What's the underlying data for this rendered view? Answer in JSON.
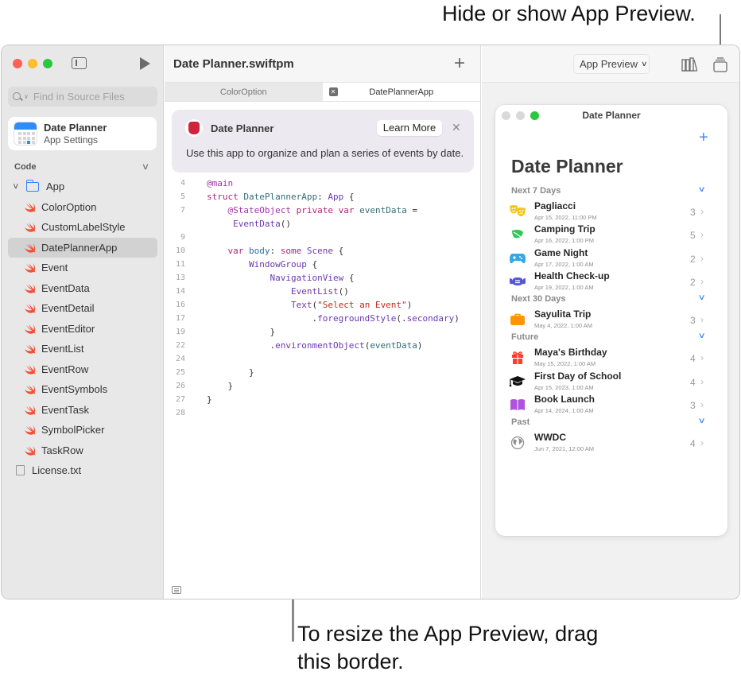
{
  "callouts": {
    "top": "Hide or show App Preview.",
    "bottom": "To resize the App Preview, drag this border."
  },
  "sidebar": {
    "search_placeholder": "Find in Source Files",
    "app_settings": {
      "title": "Date Planner",
      "subtitle": "App Settings"
    },
    "section_label": "Code",
    "folder": "App",
    "files": [
      "ColorOption",
      "CustomLabelStyle",
      "DatePlannerApp",
      "Event",
      "EventData",
      "EventDetail",
      "EventEditor",
      "EventList",
      "EventRow",
      "EventSymbols",
      "EventTask",
      "SymbolPicker",
      "TaskRow"
    ],
    "selected_file": "DatePlannerApp",
    "extra_file": "License.txt"
  },
  "editor": {
    "project_title": "Date Planner.swiftpm",
    "tabs": [
      {
        "label": "ColorOption",
        "active": false
      },
      {
        "label": "DatePlannerApp",
        "active": true
      }
    ],
    "banner": {
      "title": "Date Planner",
      "learn_more": "Learn More",
      "description": "Use this app to organize and plan a series of events by date."
    },
    "code_line_numbers": [
      "4",
      "5",
      "7",
      "",
      "9",
      "10",
      "11",
      "13",
      "14",
      "16",
      "17",
      "19",
      "22",
      "24",
      "25",
      "26",
      "27",
      "28"
    ],
    "code_lines": [
      "@main",
      "struct DatePlannerApp: App {",
      "    @StateObject private var eventData =",
      "     EventData()",
      "",
      "    var body: some Scene {",
      "        WindowGroup {",
      "            NavigationView {",
      "                EventList()",
      "                Text(\"Select an Event\")",
      "                    .foregroundStyle(.secondary)",
      "            }",
      "            .environmentObject(eventData)",
      "",
      "        }",
      "    }",
      "}",
      ""
    ]
  },
  "preview": {
    "selector_label": "App Preview",
    "window_title": "Date Planner",
    "heading": "Date Planner",
    "sections": [
      {
        "label": "Next 7 Days",
        "events": [
          {
            "title": "Pagliacci",
            "date": "Apr 15, 2022, 11:00 PM",
            "count": "3",
            "icon": "theater-masks-icon",
            "color": "#f5c518"
          },
          {
            "title": "Camping Trip",
            "date": "Apr 16, 2022, 1:00 PM",
            "count": "5",
            "icon": "leaf-icon",
            "color": "#34c759"
          },
          {
            "title": "Game Night",
            "date": "Apr 17, 2022, 1:00 AM",
            "count": "2",
            "icon": "gamecontroller-icon",
            "color": "#32a8e6"
          },
          {
            "title": "Health Check-up",
            "date": "Apr 19, 2022, 1:00 AM",
            "count": "2",
            "icon": "mask-icon",
            "color": "#5856d6"
          }
        ]
      },
      {
        "label": "Next 30 Days",
        "events": [
          {
            "title": "Sayulita Trip",
            "date": "May 4, 2022, 1:00 AM",
            "count": "3",
            "icon": "suitcase-icon",
            "color": "#ff9500"
          }
        ]
      },
      {
        "label": "Future",
        "events": [
          {
            "title": "Maya's Birthday",
            "date": "May 15, 2022, 1:00 AM",
            "count": "4",
            "icon": "gift-icon",
            "color": "#ff3b30"
          },
          {
            "title": "First Day of School",
            "date": "Apr 15, 2023, 1:00 AM",
            "count": "4",
            "icon": "graduationcap-icon",
            "color": "#111111"
          },
          {
            "title": "Book Launch",
            "date": "Apr 14, 2024, 1:00 AM",
            "count": "3",
            "icon": "book-icon",
            "color": "#af52de"
          }
        ]
      },
      {
        "label": "Past",
        "events": [
          {
            "title": "WWDC",
            "date": "Jun 7, 2021, 12:00 AM",
            "count": "4",
            "icon": "globe-icon",
            "color": "#8e8e8e"
          }
        ]
      }
    ]
  },
  "colors": {
    "accent": "#3b8bf6",
    "swift_orange": "#f05138",
    "traffic_red": "#fe5f57",
    "traffic_yellow": "#febc2e",
    "traffic_green": "#28c840"
  }
}
